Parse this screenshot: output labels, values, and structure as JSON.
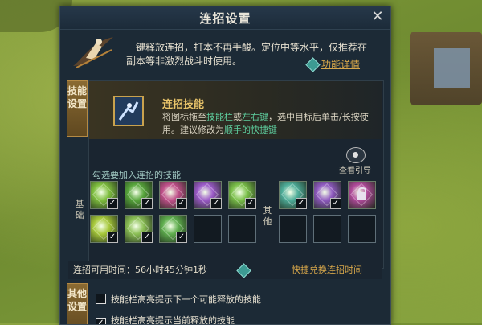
{
  "window": {
    "title": "连招设置",
    "close_symbol": "✕"
  },
  "intro": {
    "text": "一键释放连招，打本不再手酸。定位中等水平，仅推荐在副本等非激烈战斗时使用。",
    "detail_link": "功能详情",
    "hint_symbol": "?"
  },
  "skill_section": {
    "tab_label": "技能设置",
    "combo_title": "连招技能",
    "desc_part1": "将图标拖至",
    "desc_hl1": "技能栏",
    "desc_part2": "或",
    "desc_hl2": "左右键",
    "desc_part3": "，选中目标后单击/长按使用。建议修改为",
    "desc_hl3": "顺手的快捷键",
    "view_guide": "查看引导",
    "select_label": "勾选要加入连招的技能",
    "basic_label": "基础",
    "other_label": "其他",
    "basic_slots": [
      {
        "filled": true,
        "checked": true,
        "color": "#7fbf3f"
      },
      {
        "filled": true,
        "checked": true,
        "color": "#58a63c"
      },
      {
        "filled": true,
        "checked": true,
        "color": "#c0508a"
      },
      {
        "filled": true,
        "checked": true,
        "color": "#9b5ac8"
      },
      {
        "filled": true,
        "checked": true,
        "color": "#7bc04a"
      },
      {
        "filled": true,
        "checked": true,
        "color": "#a6c83a"
      },
      {
        "filled": true,
        "checked": true,
        "color": "#8bbf55"
      },
      {
        "filled": true,
        "checked": true,
        "color": "#5fae4e"
      },
      {
        "filled": false,
        "checked": false
      },
      {
        "filled": false,
        "checked": false
      }
    ],
    "other_slots": [
      {
        "filled": true,
        "checked": true,
        "color": "#4fae9a"
      },
      {
        "filled": true,
        "checked": true,
        "color": "#8f5ac0"
      },
      {
        "filled": true,
        "checked": false,
        "locked": true,
        "color": "#b04a9a"
      },
      {
        "filled": false,
        "checked": false
      },
      {
        "filled": false,
        "checked": false
      },
      {
        "filled": false,
        "checked": false
      }
    ],
    "check_symbol": "✓"
  },
  "time": {
    "text": "连招可用时间：56小时45分钟1秒",
    "exchange_link": "快捷兑换连招时间"
  },
  "other_settings": {
    "tab_label": "其他设置",
    "options": [
      {
        "label": "技能栏高亮提示下一个可能释放的技能",
        "checked": false
      },
      {
        "label": "技能栏高亮提示当前释放的技能",
        "checked": true
      }
    ]
  }
}
